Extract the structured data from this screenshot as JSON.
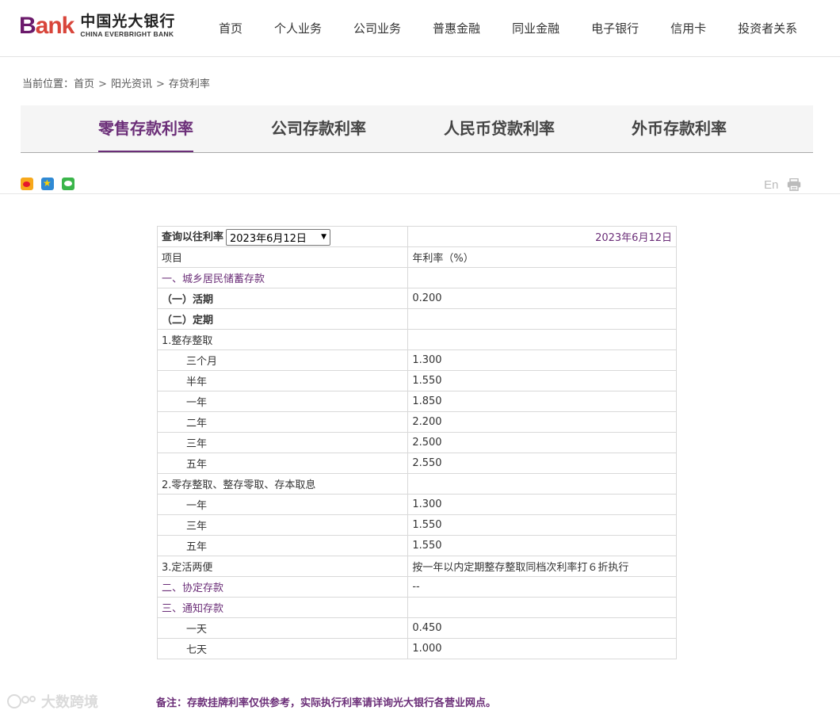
{
  "header": {
    "logo_bank_first": "B",
    "logo_bank_rest": "ank",
    "logo_cn": "中国光大银行",
    "logo_en": "CHINA EVERBRIGHT BANK",
    "nav": [
      "首页",
      "个人业务",
      "公司业务",
      "普惠金融",
      "同业金融",
      "电子银行",
      "信用卡",
      "投资者关系"
    ]
  },
  "breadcrumb": {
    "label": "当前位置：",
    "items": [
      "首页",
      "阳光资讯",
      "存贷利率"
    ],
    "sep": ">"
  },
  "tabs": [
    "零售存款利率",
    "公司存款利率",
    "人民币贷款利率",
    "外币存款利率"
  ],
  "active_tab": 0,
  "share": {
    "icons": [
      "weibo-icon",
      "qzone-icon",
      "wechat-icon"
    ],
    "en_label": "En"
  },
  "table": {
    "query_label": "查询以往利率",
    "selected_date": "2023年6月12日",
    "date_display": "2023年6月12日",
    "header": [
      "项目",
      "年利率（%）"
    ],
    "rows": [
      {
        "item": "一、城乡居民储蓄存款",
        "rate": "",
        "style": "purple"
      },
      {
        "item": "（一）活期",
        "rate": "0.200",
        "style": "bold"
      },
      {
        "item": "（二）定期",
        "rate": "",
        "style": "bold"
      },
      {
        "item": "1.整存整取",
        "rate": "",
        "style": "plain"
      },
      {
        "item": "三个月",
        "rate": "1.300",
        "style": "indent"
      },
      {
        "item": "半年",
        "rate": "1.550",
        "style": "indent"
      },
      {
        "item": "一年",
        "rate": "1.850",
        "style": "indent"
      },
      {
        "item": "二年",
        "rate": "2.200",
        "style": "indent"
      },
      {
        "item": "三年",
        "rate": "2.500",
        "style": "indent"
      },
      {
        "item": "五年",
        "rate": "2.550",
        "style": "indent"
      },
      {
        "item": "2.零存整取、整存零取、存本取息",
        "rate": "",
        "style": "plain"
      },
      {
        "item": "一年",
        "rate": "1.300",
        "style": "indent"
      },
      {
        "item": "三年",
        "rate": "1.550",
        "style": "indent"
      },
      {
        "item": "五年",
        "rate": "1.550",
        "style": "indent"
      },
      {
        "item": "3.定活两便",
        "rate": "按一年以内定期整存整取同档次利率打６折执行",
        "style": "plain"
      },
      {
        "item": "二、协定存款",
        "rate": "--",
        "style": "purple"
      },
      {
        "item": "三、通知存款",
        "rate": "",
        "style": "purple"
      },
      {
        "item": "一天",
        "rate": "0.450",
        "style": "indent"
      },
      {
        "item": "七天",
        "rate": "1.000",
        "style": "indent"
      }
    ]
  },
  "note": "备注：存款挂牌利率仅供参考，实际执行利率请详询光大银行各营业网点。",
  "watermark": "大数跨境",
  "colors": {
    "brand_purple": "#6b2e78",
    "logo_red": "#d8453a"
  }
}
